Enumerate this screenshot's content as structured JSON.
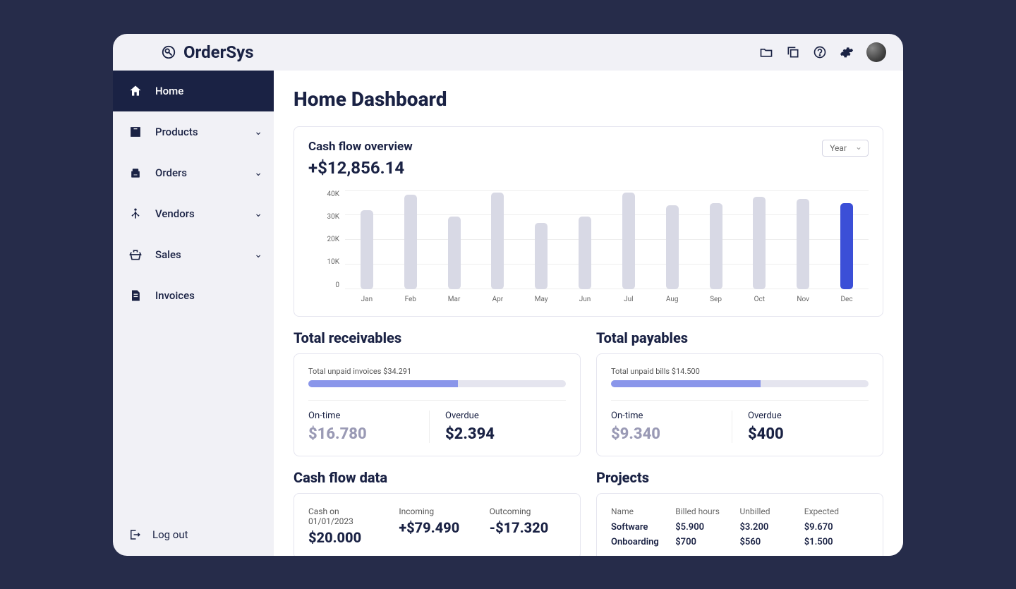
{
  "brand": "OrderSys",
  "nav": {
    "items": [
      {
        "label": "Home",
        "expandable": false
      },
      {
        "label": "Products",
        "expandable": true
      },
      {
        "label": "Orders",
        "expandable": true
      },
      {
        "label": "Vendors",
        "expandable": true
      },
      {
        "label": "Sales",
        "expandable": true
      },
      {
        "label": "Invoices",
        "expandable": false
      }
    ],
    "logout": "Log out"
  },
  "page": {
    "title": "Home Dashboard"
  },
  "cashflow": {
    "title": "Cash flow overview",
    "total": "+$12,856.14",
    "period": "Year"
  },
  "chart_data": {
    "type": "bar",
    "title": "Cash flow overview",
    "ylabel": "",
    "xlabel": "",
    "ylim": [
      0,
      45
    ],
    "y_ticks": [
      "40K",
      "30K",
      "20K",
      "10K",
      "0"
    ],
    "categories": [
      "Jan",
      "Feb",
      "Mar",
      "Apr",
      "May",
      "Jun",
      "Jul",
      "Aug",
      "Sep",
      "Oct",
      "Nov",
      "Dec"
    ],
    "values": [
      36,
      43,
      33,
      44,
      30,
      33,
      44,
      38,
      39,
      42,
      41,
      39
    ],
    "highlight_index": 11
  },
  "receivables": {
    "title": "Total receivables",
    "subtitle": "Total unpaid invoices $34.291",
    "progress_pct": 58,
    "ontime_label": "On-time",
    "ontime_value": "$16.780",
    "overdue_label": "Overdue",
    "overdue_value": "$2.394"
  },
  "payables": {
    "title": "Total payables",
    "subtitle": "Total unpaid bills $14.500",
    "progress_pct": 58,
    "ontime_label": "On-time",
    "ontime_value": "$9.340",
    "overdue_label": "Overdue",
    "overdue_value": "$400"
  },
  "cashdata": {
    "title": "Cash flow data",
    "items": [
      {
        "label": "Cash on 01/01/2023",
        "value": "$20.000"
      },
      {
        "label": "Incoming",
        "value": "+$79.490"
      },
      {
        "label": "Outcoming",
        "value": "-$17.320"
      }
    ]
  },
  "projects": {
    "title": "Projects",
    "columns": [
      "Name",
      "Billed hours",
      "Unbilled",
      "Expected"
    ],
    "rows": [
      {
        "name": "Software",
        "billed": "$5.900",
        "unbilled": "$3.200",
        "expected": "$9.670"
      },
      {
        "name": "Onboarding",
        "billed": "$700",
        "unbilled": "$560",
        "expected": "$1.500"
      }
    ]
  }
}
